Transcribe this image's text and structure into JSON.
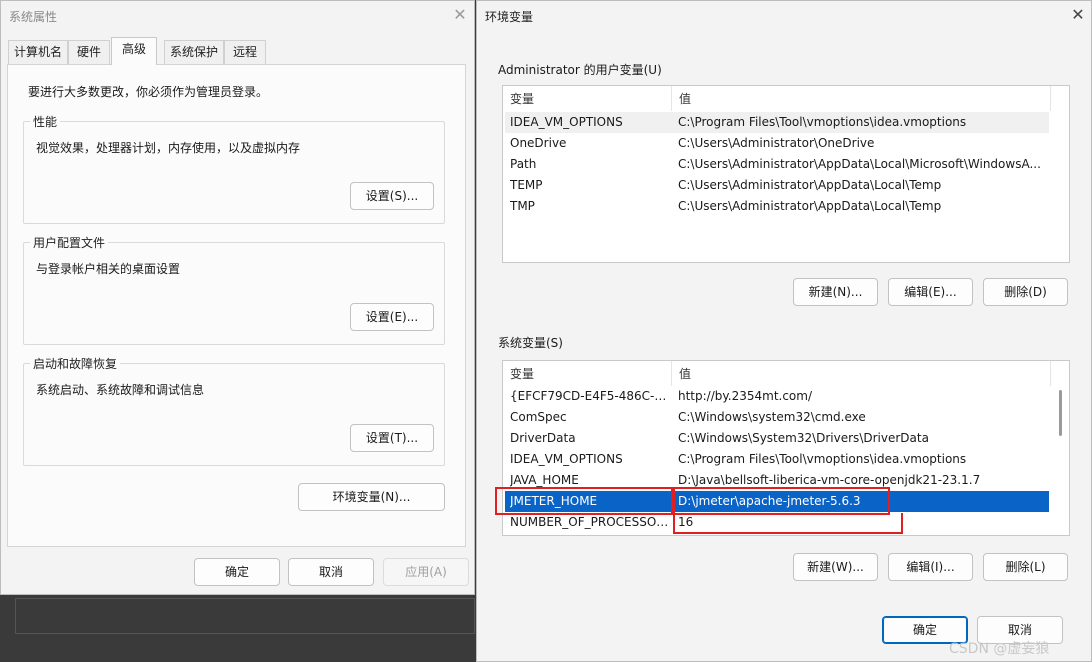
{
  "sys_props": {
    "title": "系统属性",
    "tabs": [
      "计算机名",
      "硬件",
      "高级",
      "系统保护",
      "远程"
    ],
    "intro": "要进行大多数更改，你必须作为管理员登录。",
    "perf": {
      "label": "性能",
      "desc": "视觉效果，处理器计划，内存使用，以及虚拟内存",
      "button": "设置(S)..."
    },
    "profile": {
      "label": "用户配置文件",
      "desc": "与登录帐户相关的桌面设置",
      "button": "设置(E)..."
    },
    "startup": {
      "label": "启动和故障恢复",
      "desc": "系统启动、系统故障和调试信息",
      "button": "设置(T)..."
    },
    "env_button": "环境变量(N)...",
    "ok": "确定",
    "cancel": "取消",
    "apply": "应用(A)"
  },
  "env": {
    "title": "环境变量",
    "user_label": "Administrator 的用户变量(U)",
    "col_var": "变量",
    "col_val": "值",
    "user_vars": [
      {
        "name": "IDEA_VM_OPTIONS",
        "value": "C:\\Program Files\\Tool\\vmoptions\\idea.vmoptions"
      },
      {
        "name": "OneDrive",
        "value": "C:\\Users\\Administrator\\OneDrive"
      },
      {
        "name": "Path",
        "value": "C:\\Users\\Administrator\\AppData\\Local\\Microsoft\\WindowsA..."
      },
      {
        "name": "TEMP",
        "value": "C:\\Users\\Administrator\\AppData\\Local\\Temp"
      },
      {
        "name": "TMP",
        "value": "C:\\Users\\Administrator\\AppData\\Local\\Temp"
      }
    ],
    "user_buttons": {
      "new": "新建(N)...",
      "edit": "编辑(E)...",
      "delete": "删除(D)"
    },
    "sys_label": "系统变量(S)",
    "sys_vars": [
      {
        "name": "{EFCF79CD-E4F5-486C-9D...",
        "value": "http://by.2354mt.com/"
      },
      {
        "name": "ComSpec",
        "value": "C:\\Windows\\system32\\cmd.exe"
      },
      {
        "name": "DriverData",
        "value": "C:\\Windows\\System32\\Drivers\\DriverData"
      },
      {
        "name": "IDEA_VM_OPTIONS",
        "value": "C:\\Program Files\\Tool\\vmoptions\\idea.vmoptions"
      },
      {
        "name": "JAVA_HOME",
        "value": "D:\\Java\\bellsoft-liberica-vm-core-openjdk21-23.1.7"
      },
      {
        "name": "JMETER_HOME",
        "value": "D:\\jmeter\\apache-jmeter-5.6.3"
      },
      {
        "name": "NUMBER_OF_PROCESSORS",
        "value": "16"
      }
    ],
    "sys_buttons": {
      "new": "新建(W)...",
      "edit": "编辑(I)...",
      "delete": "删除(L)"
    },
    "ok": "确定",
    "cancel": "取消"
  },
  "watermark": "CSDN @虚妄狼",
  "colors": {
    "selection": "#0a64c8",
    "highlight_box": "#e02020",
    "primary_border": "#0067c0"
  }
}
